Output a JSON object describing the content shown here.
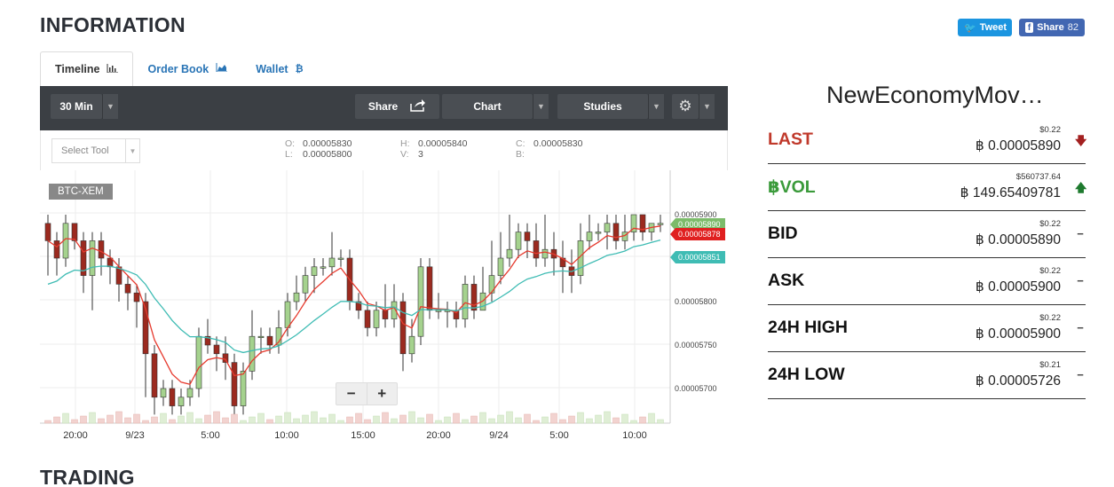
{
  "header": {
    "title": "INFORMATION",
    "trading_title": "TRADING"
  },
  "social": {
    "tweet_label": "Tweet",
    "share_label": "Share",
    "share_count": "82"
  },
  "tabs": [
    {
      "label": "Timeline",
      "icon": "bar-chart-icon",
      "active": true
    },
    {
      "label": "Order Book",
      "icon": "area-chart-icon",
      "active": false
    },
    {
      "label": "Wallet",
      "icon": "bitcoin-icon",
      "active": false
    }
  ],
  "toolbar": {
    "interval": "30 Min",
    "share": "Share",
    "chart": "Chart",
    "studies": "Studies",
    "select_tool": "Select Tool"
  },
  "ohlc": {
    "o_key": "O:",
    "o": "0.00005830",
    "l_key": "L:",
    "l": "0.00005800",
    "h_key": "H:",
    "h": "0.00005840",
    "v_key": "V:",
    "v": "3",
    "c_key": "C:",
    "c": "0.00005830",
    "b_key": "B:",
    "b": ""
  },
  "chart": {
    "pair": "BTC-XEM",
    "price_ticks": [
      "0.00005900",
      "0.00005800",
      "0.00005750",
      "0.00005700"
    ],
    "time_ticks": [
      "20:00",
      "9/23",
      "5:00",
      "10:00",
      "15:00",
      "20:00",
      "9/24",
      "5:00",
      "10:00"
    ],
    "markers": [
      {
        "label": "0.00005890",
        "color": "#7cbb6a"
      },
      {
        "label": "0.00005878",
        "color": "#e02020"
      },
      {
        "label": "0.00005851",
        "color": "#3fbcb4"
      }
    ],
    "colors": {
      "up": "#a5d28e",
      "down": "#9b2a1f",
      "ema_fast": "#e63a2e",
      "ema_slow": "#3fbcb4"
    }
  },
  "market": {
    "name": "NewEconomyMov…"
  },
  "stats": [
    {
      "label": "LAST",
      "style": "red",
      "usd": "$0.22",
      "value": "0.00005890",
      "indicator": "down"
    },
    {
      "label": "฿VOL",
      "style": "green",
      "usd": "$560737.64",
      "value": "149.65409781",
      "indicator": "up"
    },
    {
      "label": "BID",
      "style": "",
      "usd": "$0.22",
      "value": "0.00005890",
      "indicator": "flat"
    },
    {
      "label": "ASK",
      "style": "",
      "usd": "$0.22",
      "value": "0.00005900",
      "indicator": "flat"
    },
    {
      "label": "24H HIGH",
      "style": "",
      "usd": "$0.22",
      "value": "0.00005900",
      "indicator": "flat"
    },
    {
      "label": "24H LOW",
      "style": "",
      "usd": "$0.21",
      "value": "0.00005726",
      "indicator": "flat"
    }
  ],
  "currency_symbol": "฿"
}
